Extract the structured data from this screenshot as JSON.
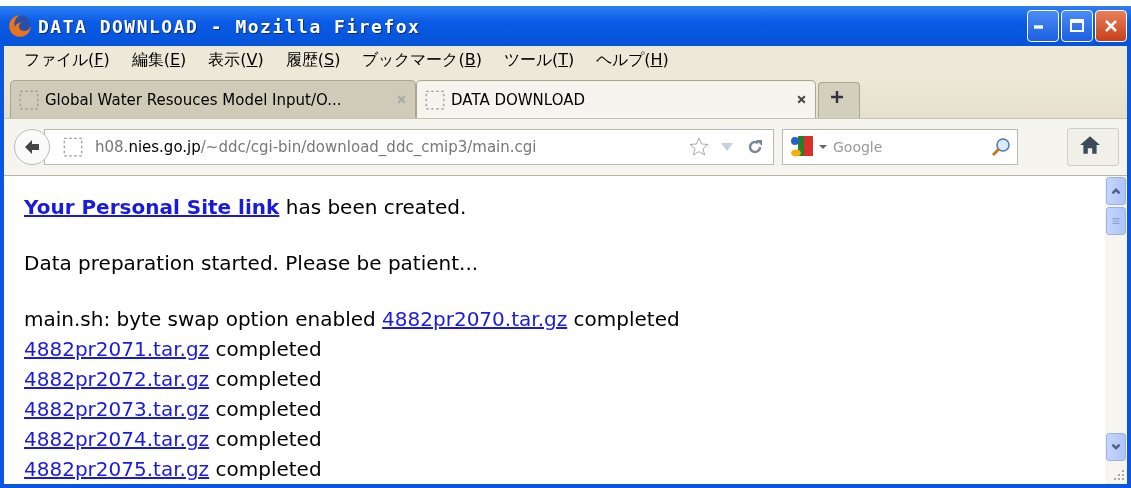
{
  "window": {
    "title": "DATA DOWNLOAD - Mozilla Firefox"
  },
  "menu": [
    "ファイル(F)",
    "編集(E)",
    "表示(V)",
    "履歴(S)",
    "ブックマーク(B)",
    "ツール(T)",
    "ヘルプ(H)"
  ],
  "tabs": [
    {
      "label": "Global Water Resouces Model Input/O...",
      "selected": false
    },
    {
      "label": "DATA DOWNLOAD",
      "selected": true
    }
  ],
  "address": {
    "host_prefix": "h08.",
    "host": "nies.go.jp",
    "path": "/~ddc/cgi-bin/download_ddc_cmip3/main.cgi"
  },
  "search": {
    "placeholder": "Google"
  },
  "content": {
    "notice": {
      "link": "Your Personal Site link",
      "text": " has been created."
    },
    "status": "Data preparation started. Please be patient...",
    "log": [
      {
        "prefix": "main.sh: byte swap option enabled ",
        "link": "4882pr2070.tar.gz",
        "suffix": " completed"
      },
      {
        "link": "4882pr2071.tar.gz",
        "suffix": " completed"
      },
      {
        "link": "4882pr2072.tar.gz",
        "suffix": " completed"
      },
      {
        "link": "4882pr2073.tar.gz",
        "suffix": " completed"
      },
      {
        "link": "4882pr2074.tar.gz",
        "suffix": " completed"
      },
      {
        "link": "4882pr2075.tar.gz",
        "suffix": " completed"
      }
    ]
  }
}
